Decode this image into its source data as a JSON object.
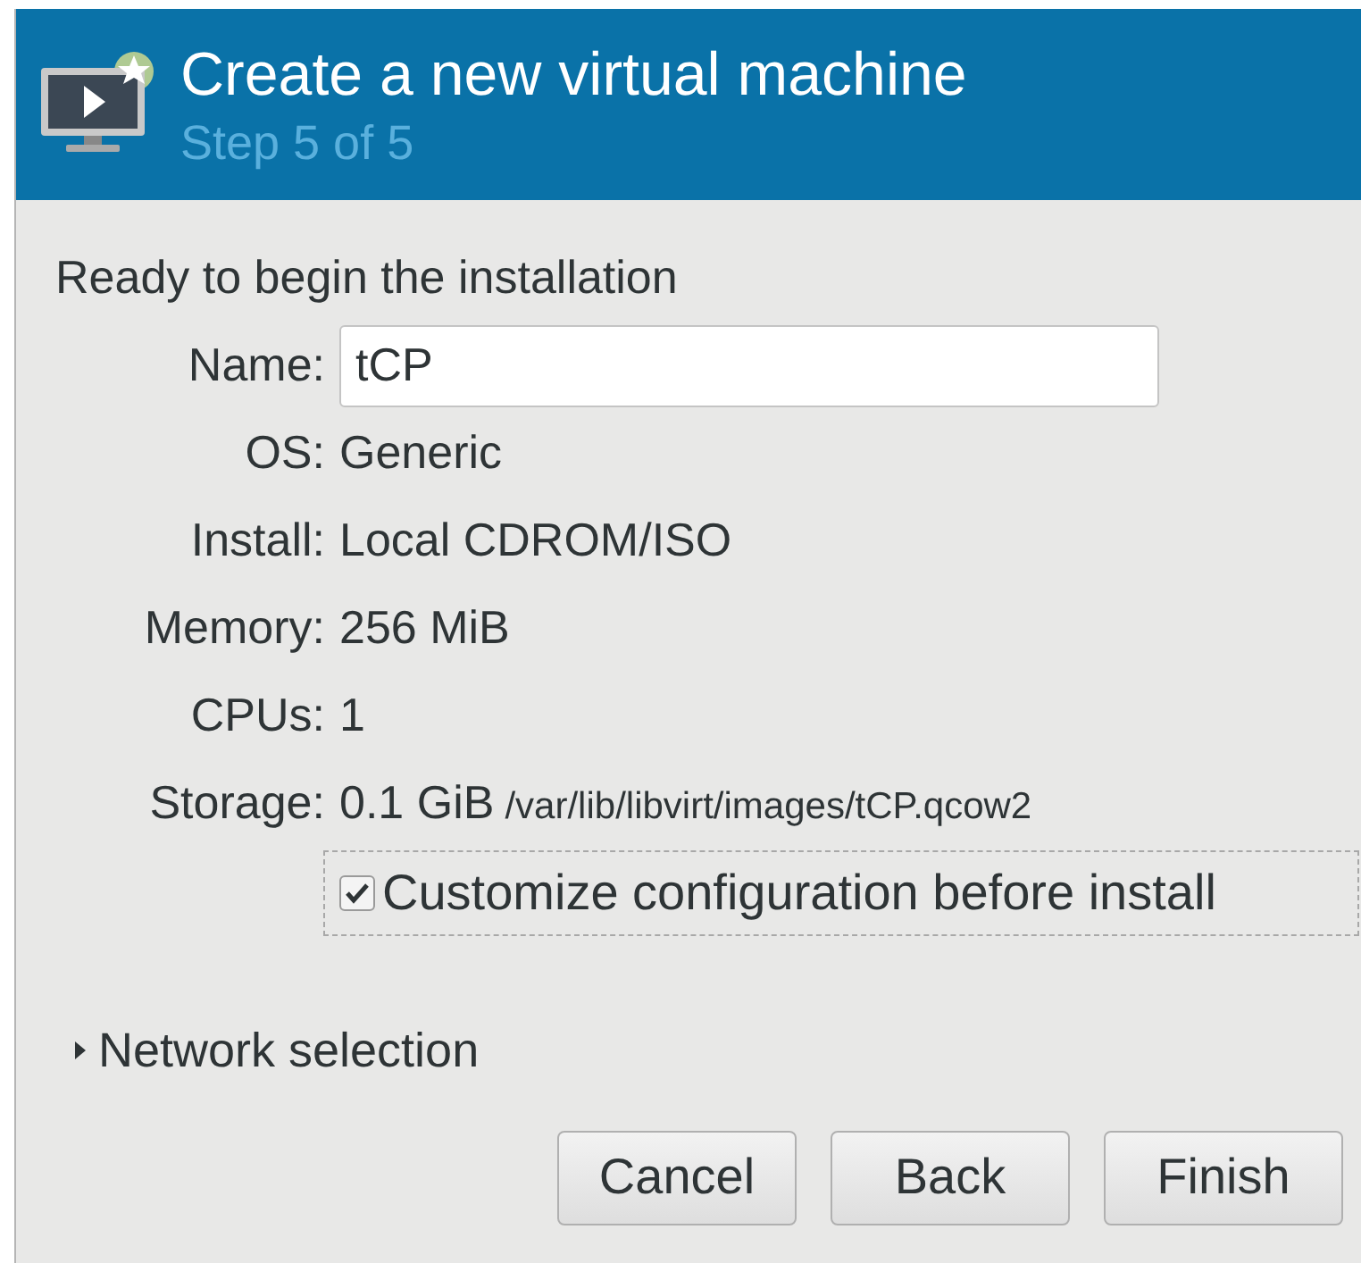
{
  "header": {
    "title": "Create a new virtual machine",
    "subtitle": "Step 5 of 5"
  },
  "heading": "Ready to begin the installation",
  "fields": [
    {
      "kind": "input",
      "label": "Name:",
      "value": "tCP"
    },
    {
      "kind": "text",
      "label": "OS:",
      "value": "Generic"
    },
    {
      "kind": "text",
      "label": "Install:",
      "value": "Local CDROM/ISO"
    },
    {
      "kind": "text",
      "label": "Memory:",
      "value": "256 MiB"
    },
    {
      "kind": "text",
      "label": "CPUs:",
      "value": "1"
    },
    {
      "kind": "storage",
      "label": "Storage:",
      "value": "0.1 GiB",
      "path": "/var/lib/libvirt/images/tCP.qcow2"
    }
  ],
  "customize": {
    "label": "Customize configuration before install",
    "checked": true
  },
  "network": {
    "label": "Network selection",
    "expanded": false
  },
  "buttons": [
    "Cancel",
    "Back",
    "Finish"
  ]
}
